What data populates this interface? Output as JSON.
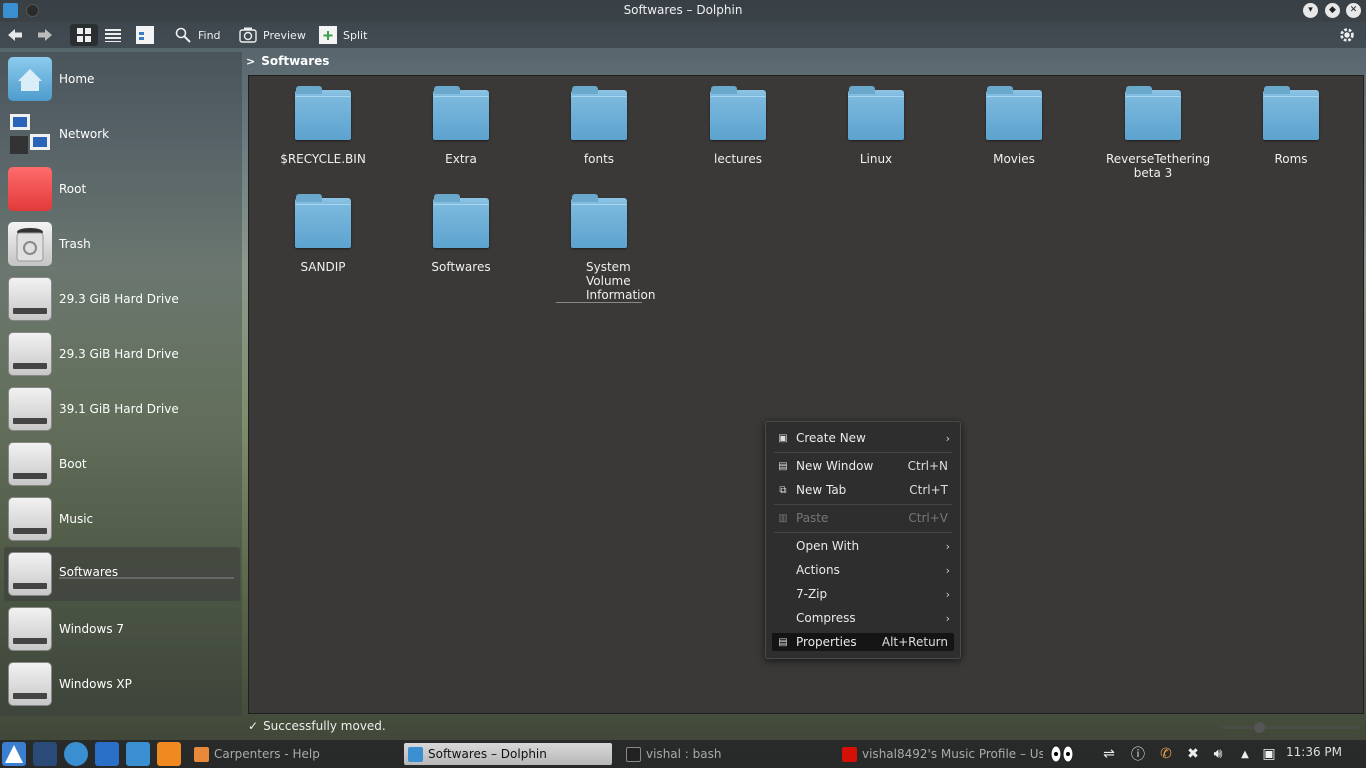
{
  "window": {
    "title": "Softwares – Dolphin"
  },
  "toolbar": {
    "find_label": "Find",
    "preview_label": "Preview",
    "split_label": "Split"
  },
  "sidebar": {
    "places": [
      {
        "label": "Home",
        "icon": "home-icon"
      },
      {
        "label": "Network",
        "icon": "network-icon"
      },
      {
        "label": "Root",
        "icon": "root-folder-icon"
      },
      {
        "label": "Trash",
        "icon": "trash-icon"
      },
      {
        "label": "29.3 GiB Hard Drive",
        "icon": "hard-drive-icon"
      },
      {
        "label": "29.3 GiB Hard Drive",
        "icon": "hard-drive-icon"
      },
      {
        "label": "39.1 GiB Hard Drive",
        "icon": "hard-drive-icon"
      },
      {
        "label": "Boot",
        "icon": "hard-drive-icon"
      },
      {
        "label": "Music",
        "icon": "hard-drive-icon"
      },
      {
        "label": "Softwares",
        "icon": "hard-drive-icon",
        "selected": true
      },
      {
        "label": "Windows 7",
        "icon": "hard-drive-icon"
      },
      {
        "label": "Windows XP",
        "icon": "hard-drive-icon"
      }
    ]
  },
  "breadcrumb": {
    "current": "Softwares"
  },
  "folders": [
    {
      "name": "$RECYCLE.BIN"
    },
    {
      "name": "Extra"
    },
    {
      "name": "fonts"
    },
    {
      "name": "lectures"
    },
    {
      "name": "Linux"
    },
    {
      "name": "Movies"
    },
    {
      "name": "ReverseTethering beta 3"
    },
    {
      "name": "Roms"
    },
    {
      "name": "SANDIP"
    },
    {
      "name": "Softwares"
    },
    {
      "name": "System Volume Information"
    }
  ],
  "context_menu": {
    "items": [
      {
        "label": "Create New",
        "shortcut": "",
        "submenu": true
      },
      {
        "label": "New Window",
        "shortcut": "Ctrl+N"
      },
      {
        "label": "New Tab",
        "shortcut": "Ctrl+T"
      },
      {
        "label": "Paste",
        "shortcut": "Ctrl+V",
        "disabled": true
      },
      {
        "label": "Open With",
        "shortcut": "",
        "submenu": true
      },
      {
        "label": "Actions",
        "shortcut": "",
        "submenu": true
      },
      {
        "label": "7-Zip",
        "shortcut": "",
        "submenu": true
      },
      {
        "label": "Compress",
        "shortcut": "",
        "submenu": true
      },
      {
        "label": "Properties",
        "shortcut": "Alt+Return",
        "highlighted": true
      }
    ]
  },
  "status": {
    "message": "Successfully moved."
  },
  "taskbar": {
    "tasks": [
      {
        "label": "Carpenters - Help"
      },
      {
        "label": "Softwares – Dolphin",
        "active": true
      },
      {
        "label": "vishal : bash"
      },
      {
        "label": "vishal8492's Music Profile – Us"
      }
    ],
    "clock": "11:36 PM"
  },
  "colors": {
    "folder": "#5ca3cf",
    "view_bg": "#3a3937",
    "menu_bg": "#2e2e2e"
  }
}
